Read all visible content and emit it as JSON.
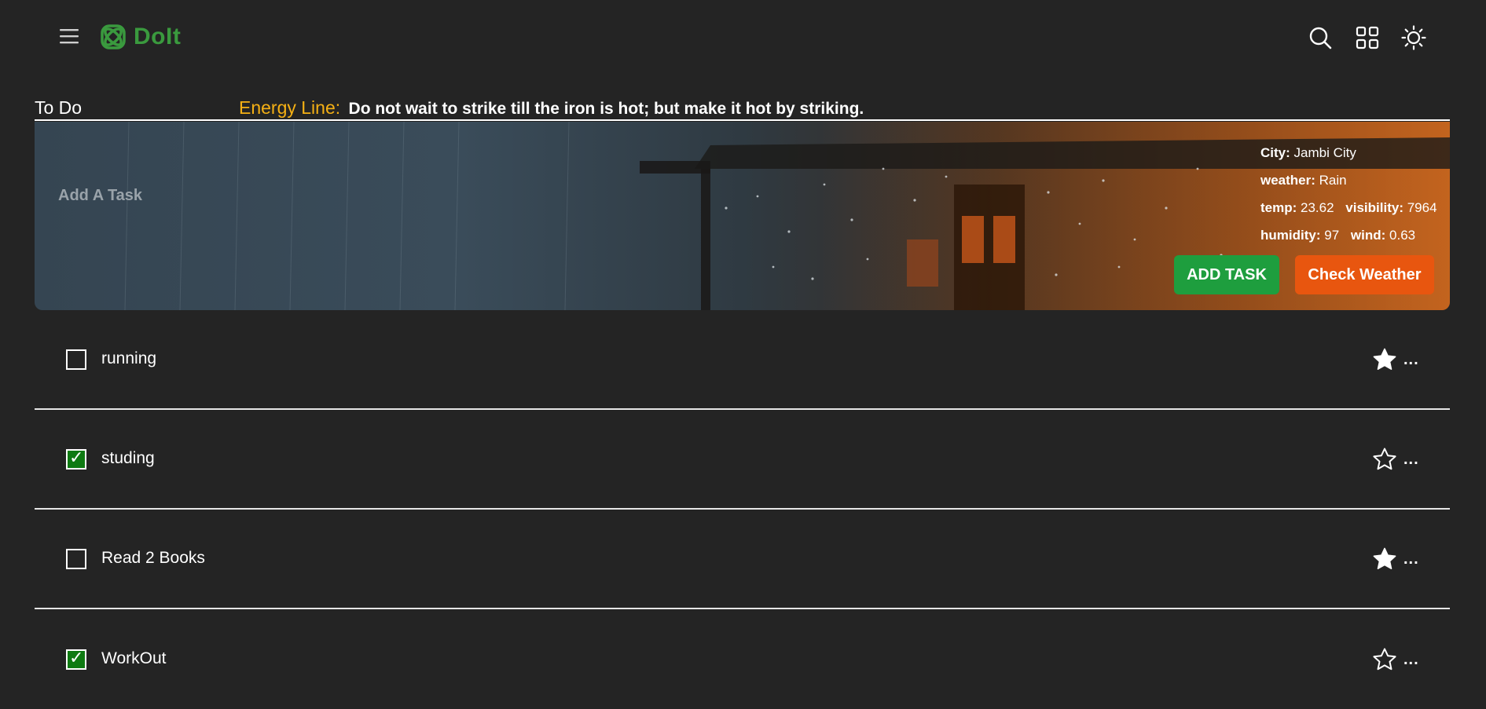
{
  "app": {
    "name": "DoIt"
  },
  "colors": {
    "logo_green": "#3a9a3e",
    "energy_label": "#f5b014",
    "add_task_bg": "#1e9e3e",
    "weather_bg": "#e8560f",
    "checked_bg": "#0e7a12"
  },
  "header": {
    "todo_title": "To Do",
    "energy_label": "Energy Line:",
    "energy_quote": "Do not wait to strike till the iron is hot; but make it hot by striking."
  },
  "add_task": {
    "placeholder": "Add A Task"
  },
  "weather": {
    "city_label": "City:",
    "city": "Jambi City",
    "weather_label": "weather:",
    "weather": "Rain",
    "temp_label": "temp:",
    "temp": "23.62",
    "visibility_label": "visibility:",
    "visibility": "7964",
    "humidity_label": "humidity:",
    "humidity": "97",
    "wind_label": "wind:",
    "wind": "0.63"
  },
  "buttons": {
    "add_task": "ADD TASK",
    "check_weather": "Check Weather"
  },
  "tasks": [
    {
      "label": "running",
      "checked": false,
      "starred": true
    },
    {
      "label": "studing",
      "checked": true,
      "starred": false
    },
    {
      "label": "Read 2 Books",
      "checked": false,
      "starred": true
    },
    {
      "label": "WorkOut",
      "checked": true,
      "starred": false
    }
  ],
  "more_label": "..."
}
